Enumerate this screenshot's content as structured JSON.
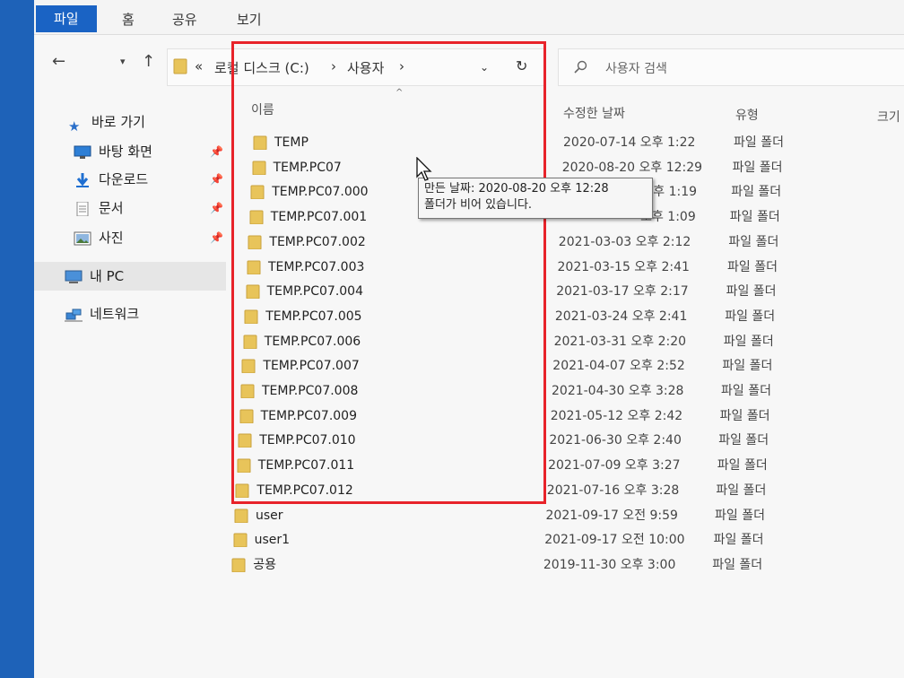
{
  "ribbon": {
    "tabs": [
      "파일",
      "홈",
      "공유",
      "보기"
    ]
  },
  "address": {
    "overflow": "«",
    "path": [
      "로컬 디스크 (C:)",
      "사용자"
    ],
    "separator": "›"
  },
  "search": {
    "placeholder": "사용자 검색"
  },
  "nav": {
    "quick_access": "바로 가기",
    "items": [
      {
        "label": "바탕 화면",
        "icon": "desktop-icon",
        "pinned": true
      },
      {
        "label": "다운로드",
        "icon": "download-icon",
        "pinned": true
      },
      {
        "label": "문서",
        "icon": "document-icon",
        "pinned": true
      },
      {
        "label": "사진",
        "icon": "picture-icon",
        "pinned": true
      }
    ],
    "this_pc": "내 PC",
    "network": "네트워크"
  },
  "columns": {
    "name": "이름",
    "date": "수정한 날짜",
    "type": "유형",
    "size": "크기"
  },
  "files": [
    {
      "name": "TEMP",
      "date": "2020-07-14 오후 1:22",
      "type": "파일 폴더"
    },
    {
      "name": "TEMP.PC07",
      "date": "2020-08-20 오후 12:29",
      "type": "파일 폴더"
    },
    {
      "name": "TEMP.PC07.000",
      "date": "오후 1:19",
      "type": "파일 폴더"
    },
    {
      "name": "TEMP.PC07.001",
      "date": "오후 1:09",
      "type": "파일 폴더"
    },
    {
      "name": "TEMP.PC07.002",
      "date": "2021-03-03 오후 2:12",
      "type": "파일 폴더"
    },
    {
      "name": "TEMP.PC07.003",
      "date": "2021-03-15 오후 2:41",
      "type": "파일 폴더"
    },
    {
      "name": "TEMP.PC07.004",
      "date": "2021-03-17 오후 2:17",
      "type": "파일 폴더"
    },
    {
      "name": "TEMP.PC07.005",
      "date": "2021-03-24 오후 2:41",
      "type": "파일 폴더"
    },
    {
      "name": "TEMP.PC07.006",
      "date": "2021-03-31 오후 2:20",
      "type": "파일 폴더"
    },
    {
      "name": "TEMP.PC07.007",
      "date": "2021-04-07 오후 2:52",
      "type": "파일 폴더"
    },
    {
      "name": "TEMP.PC07.008",
      "date": "2021-04-30 오후 3:28",
      "type": "파일 폴더"
    },
    {
      "name": "TEMP.PC07.009",
      "date": "2021-05-12 오후 2:42",
      "type": "파일 폴더"
    },
    {
      "name": "TEMP.PC07.010",
      "date": "2021-06-30 오후 2:40",
      "type": "파일 폴더"
    },
    {
      "name": "TEMP.PC07.011",
      "date": "2021-07-09 오후 3:27",
      "type": "파일 폴더"
    },
    {
      "name": "TEMP.PC07.012",
      "date": "2021-07-16 오후 3:28",
      "type": "파일 폴더"
    },
    {
      "name": "user",
      "date": "2021-09-17 오전 9:59",
      "type": "파일 폴더"
    },
    {
      "name": "user1",
      "date": "2021-09-17 오전 10:00",
      "type": "파일 폴더"
    },
    {
      "name": "공용",
      "date": "2019-11-30 오후 3:00",
      "type": "파일 폴더"
    }
  ],
  "tooltip": {
    "line1": "만든 날짜: 2020-08-20 오후 12:28",
    "line2": "폴더가 비어 있습니다."
  },
  "colors": {
    "file_tab": "#1a63c4",
    "folder": "#e8c45a",
    "highlight": "#e8232a"
  }
}
